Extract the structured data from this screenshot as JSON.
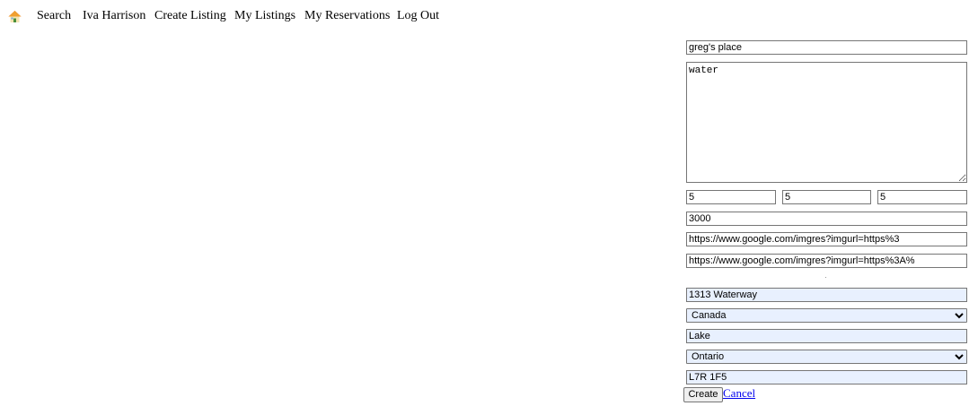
{
  "nav": {
    "home_icon": "home-icon",
    "items": [
      {
        "label": "Search"
      },
      {
        "label": "Iva Harrison"
      },
      {
        "label": "Create Listing"
      },
      {
        "label": "My Listings"
      },
      {
        "label": "My Reservations"
      },
      {
        "label": "Log Out"
      }
    ]
  },
  "form": {
    "title_value": "greg's place",
    "description_value": "water",
    "number_fields": [
      "5",
      "5",
      "5"
    ],
    "price_value": "3000",
    "image_url_1": "https://www.google.com/imgres?imgurl=https%3",
    "image_url_2": "https://www.google.com/imgres?imgurl=https%3A%",
    "street_value": "1313 Waterway",
    "country_selected": "Canada",
    "city_value": "Lake",
    "province_selected": "Ontario",
    "postal_value": "L7R 1F5",
    "create_label": "Create",
    "cancel_label": "Cancel"
  },
  "colors": {
    "autofill_bg": "#e8f0fe",
    "link": "#0000ee"
  }
}
